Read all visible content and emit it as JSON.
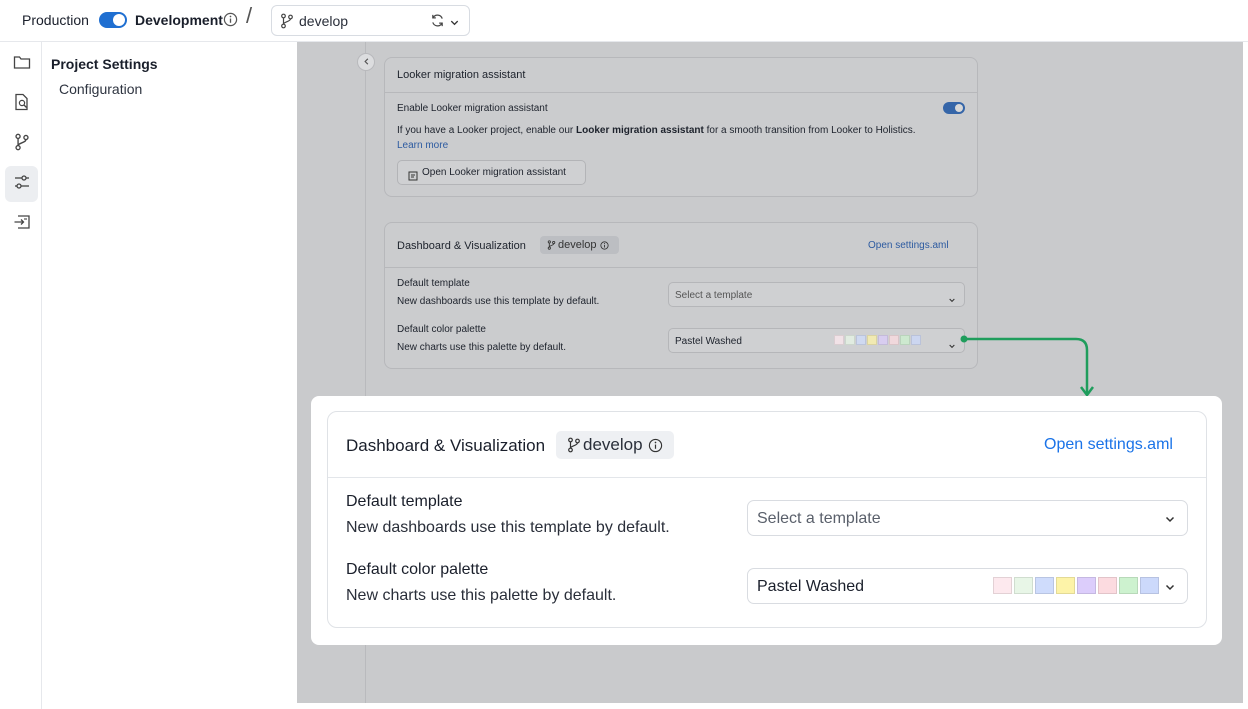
{
  "topbar": {
    "env_left": "Production",
    "env_right": "Development",
    "separator": "/",
    "branch": "develop"
  },
  "sidebar": {
    "title": "Project Settings",
    "items": [
      "Configuration"
    ]
  },
  "looker": {
    "header": "Looker migration assistant",
    "enable_label": "Enable Looker migration assistant",
    "desc_pre": "If you have a Looker project, enable our",
    "desc_bold": "Looker migration assistant",
    "desc_post": "for a smooth transition from Looker to Holistics.",
    "learn_more": "Learn more",
    "open_button": "Open Looker migration assistant"
  },
  "dashboard": {
    "header": "Dashboard & Visualization",
    "branch_badge": "develop",
    "open_settings": "Open settings.aml",
    "template_label": "Default template",
    "template_desc": "New dashboards use this template by default.",
    "template_placeholder": "Select a template",
    "palette_label": "Default color palette",
    "palette_desc": "New charts use this palette by default.",
    "palette_value": "Pastel Washed",
    "palette_colors": [
      "#fde9ee",
      "#e8f6e7",
      "#cfdcfc",
      "#fdf3a8",
      "#dccdfb",
      "#fcdbe0",
      "#cdf2cf",
      "#ccd9fb"
    ]
  },
  "colors": {
    "accent": "#1f6fd1",
    "link": "#1a73e8",
    "callout_arrow": "#1f9d5c"
  }
}
